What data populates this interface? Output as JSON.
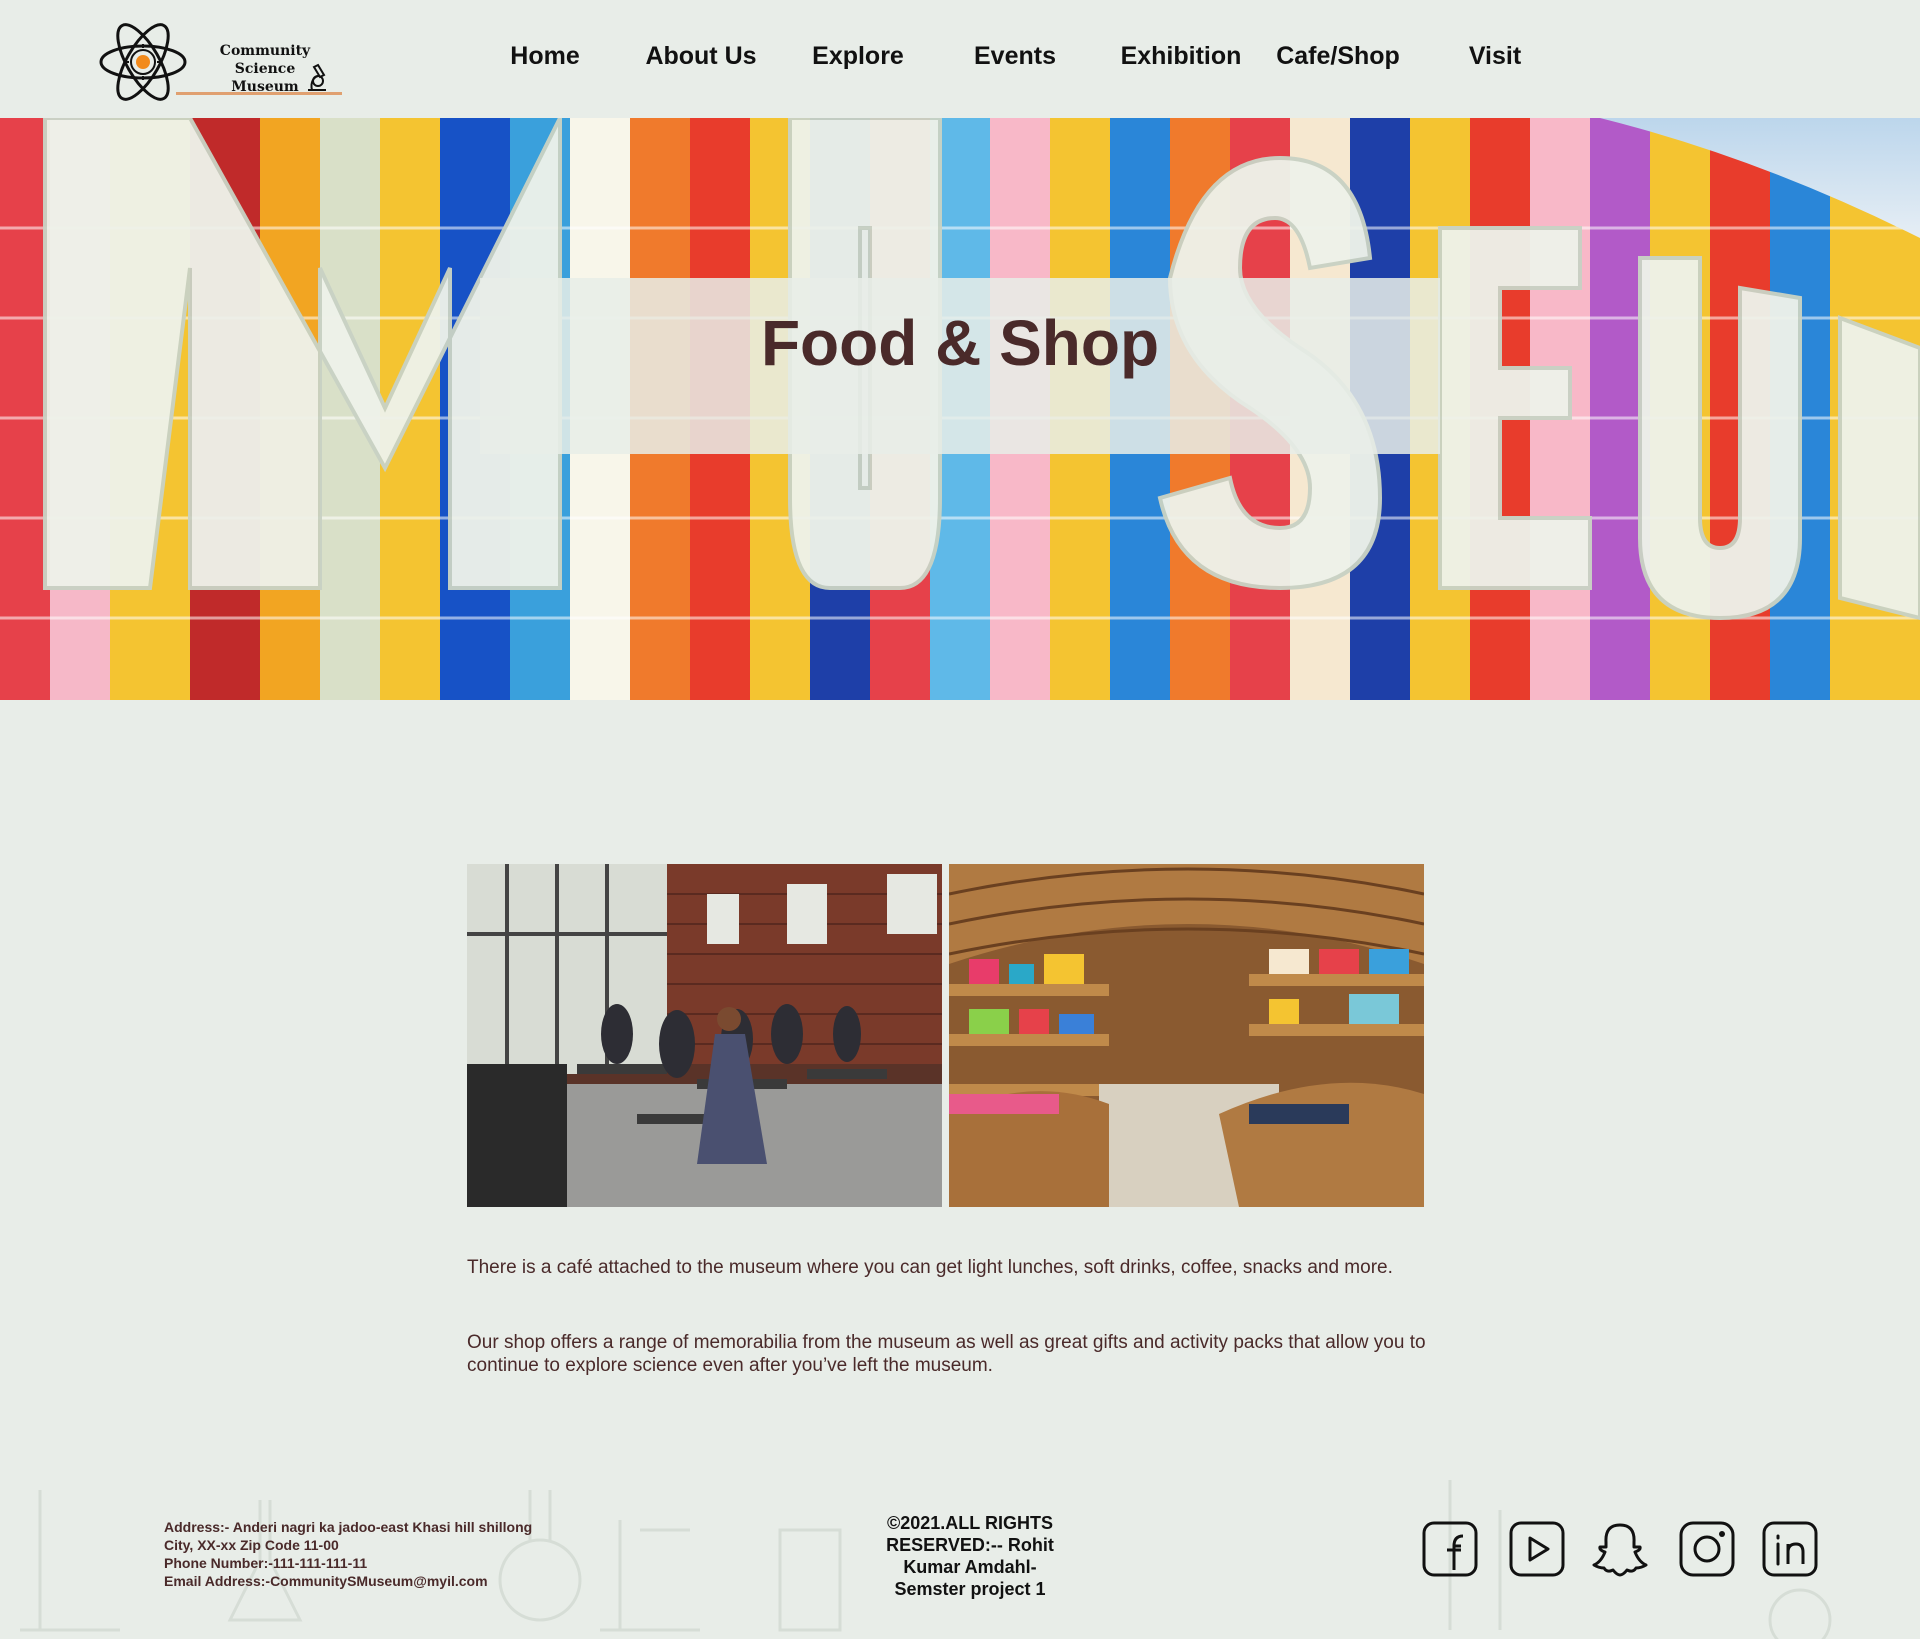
{
  "logo": {
    "line1": "Community Science",
    "line2": "Museum"
  },
  "nav": {
    "items": [
      {
        "label": "Home"
      },
      {
        "label": "About  Us"
      },
      {
        "label": "Explore"
      },
      {
        "label": "Events"
      },
      {
        "label": "Exhibition"
      },
      {
        "label": "Cafe/Shop"
      },
      {
        "label": "Visit"
      }
    ]
  },
  "hero": {
    "title": "Food & Shop",
    "background_word": "MUSEUM"
  },
  "content": {
    "paragraph1": "There is a café attached to the museum where you can get light lunches, soft drinks, coffee, snacks and more.",
    "paragraph2": "Our shop offers a range of memorabilia from the museum as well as great gifts and activity packs that allow you to continue to explore science even after you’ve left the museum.",
    "images": [
      "cafe-photo",
      "gift-shop-photo"
    ]
  },
  "footer": {
    "address_line1": "Address:- Anderi nagri ka jadoo-east Khasi hill shillong",
    "address_line2": "City, XX-xx Zip Code 11-00",
    "phone": "Phone Number:-111-111-111-11",
    "email": "Email Address:-CommunitySMuseum@myil.com",
    "copyright": "©2021.ALL RIGHTS RESERVED:-- Rohit Kumar Amdahl- Semster project 1",
    "social": [
      "facebook-icon",
      "youtube-icon",
      "snapchat-icon",
      "instagram-icon",
      "linkedin-icon"
    ]
  },
  "colors": {
    "background": "#e8ede8",
    "text_brown": "#4a2a2a",
    "accent_orange": "#e0a070"
  }
}
